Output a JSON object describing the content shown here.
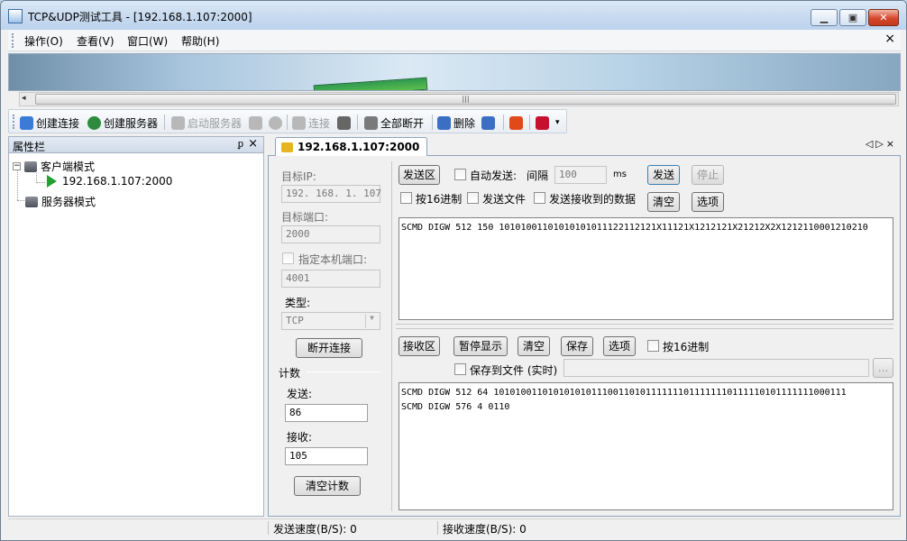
{
  "window": {
    "title": "TCP&UDP测试工具 - [192.168.1.107:2000]",
    "buttons": [
      "minimize",
      "restore",
      "close"
    ]
  },
  "menu": {
    "items": [
      "操作(O)",
      "查看(V)",
      "窗口(W)",
      "帮助(H)"
    ],
    "close_glyph": "×"
  },
  "hscroll": {
    "grip": "|||"
  },
  "toolbar": {
    "items": [
      {
        "label": "创建连接",
        "icon": "create-connection-icon",
        "color": "#3a7bd5",
        "enabled": true
      },
      {
        "label": "创建服务器",
        "icon": "create-server-icon",
        "color": "#2d8a3e",
        "enabled": true
      },
      {
        "label": "启动服务器",
        "icon": "start-server-icon",
        "color": "#b0b0b0",
        "enabled": false
      },
      {
        "label": "",
        "icon": "stop-server-icon",
        "color": "#b0b0b0",
        "enabled": false
      },
      {
        "label": "",
        "icon": "delete-server-icon",
        "color": "#b0b0b0",
        "enabled": false
      },
      {
        "label": "连接",
        "icon": "connect-icon",
        "color": "#b0b0b0",
        "enabled": false
      },
      {
        "label": "",
        "icon": "disconnect-icon",
        "color": "#666666",
        "enabled": true
      },
      {
        "label": "全部断开",
        "icon": "disconnect-all-icon",
        "color": "#7a7a7a",
        "enabled": true
      },
      {
        "label": "删除",
        "icon": "delete-icon",
        "color": "#3a6fc4",
        "enabled": true
      },
      {
        "label": "",
        "icon": "delete-all-icon",
        "color": "#3a6fc4",
        "enabled": true
      },
      {
        "label": "",
        "icon": "stop-icon",
        "color": "#e04a1a",
        "enabled": true
      },
      {
        "label": "",
        "icon": "exit-icon",
        "color": "#c8102e",
        "enabled": true
      }
    ]
  },
  "left_panel": {
    "title": "属性栏",
    "pin": "ᵖ",
    "close": "×",
    "tree": {
      "client_mode": "客户端模式",
      "client_child": "192.168.1.107:2000",
      "server_mode": "服务器模式",
      "toggle": "−"
    }
  },
  "doc_tab": {
    "label": "192.168.1.107:2000",
    "controls": "◁▷×"
  },
  "settings": {
    "target_ip_label": "目标IP:",
    "target_ip": "192. 168. 1. 107",
    "target_port_label": "目标端口:",
    "target_port": "2000",
    "local_port_label": "指定本机端口:",
    "local_port": "4001",
    "type_label": "类型:",
    "type_value": "TCP",
    "disconnect_btn": "断开连接",
    "count_label": "计数",
    "send_label": "发送:",
    "send_count": "86",
    "recv_label": "接收:",
    "recv_count": "105",
    "clear_count_btn": "清空计数"
  },
  "send_area": {
    "title": "发送区",
    "auto_send": "自动发送:",
    "interval_label": "间隔",
    "interval_value": "100",
    "interval_unit": "ms",
    "send_btn": "发送",
    "stop_btn": "停止",
    "hex16": "按16进制",
    "send_file": "发送文件",
    "send_received": "发送接收到的数据",
    "clear_btn": "清空",
    "options_btn": "选项",
    "content": "SCMD DIGW 512 150 10101001101010101011122112121X11121X1212121X21212X2X1212110001210210"
  },
  "recv_area": {
    "title": "接收区",
    "pause_btn": "暂停显示",
    "clear_btn": "清空",
    "save_btn": "保存",
    "options_btn": "选项",
    "hex16": "按16进制",
    "save_to_file": "保存到文件 (实时)",
    "browse_btn": "...",
    "content_lines": [
      "SCMD DIGW 512 64 10101001101010101011100110101111111011111110111110101111111000111",
      "SCMD DIGW 576 4 0110"
    ]
  },
  "status": {
    "send_speed": "发送速度(B/S): 0",
    "recv_speed": "接收速度(B/S): 0"
  }
}
